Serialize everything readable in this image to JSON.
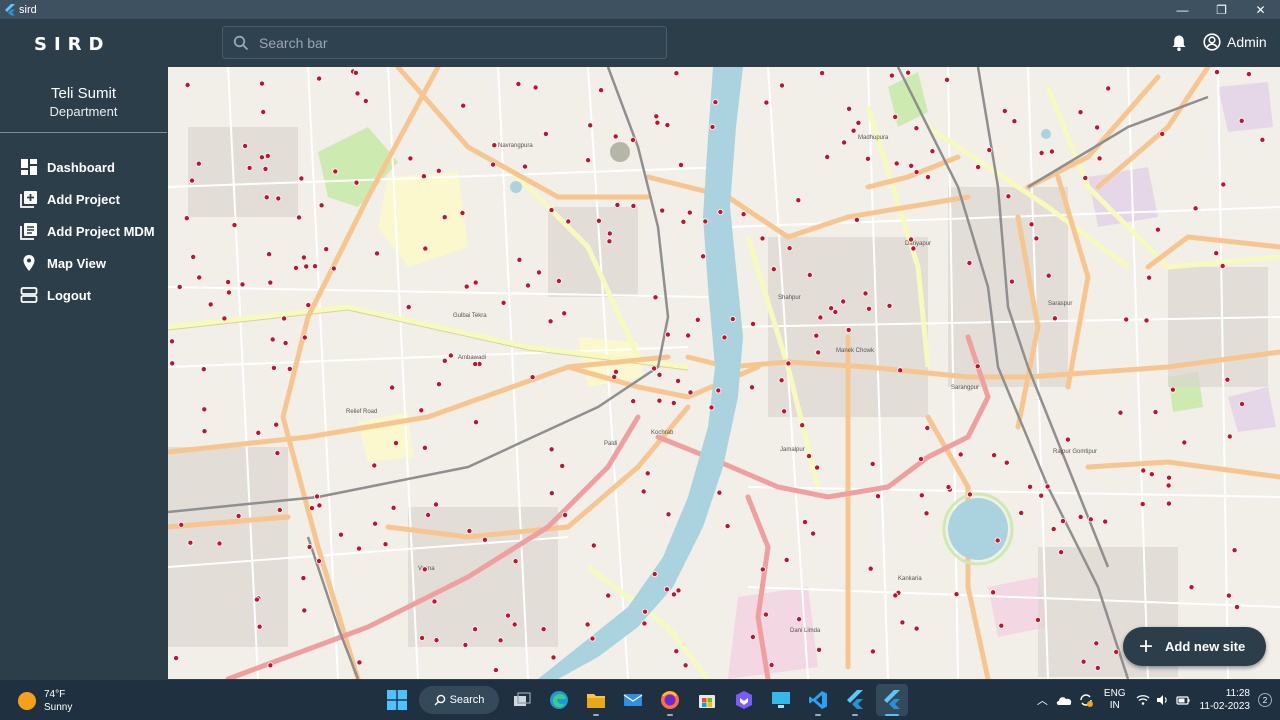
{
  "window": {
    "title": "sird",
    "minimize": "—",
    "maximize": "❐",
    "close": "✕"
  },
  "header": {
    "logo": "SIRD",
    "search_placeholder": "Search bar",
    "user_label": "Admin"
  },
  "sidebar": {
    "profile_name": "Teli Sumit",
    "profile_role": "Department",
    "items": [
      {
        "label": "Dashboard",
        "icon": "dashboard-icon"
      },
      {
        "label": "Add Project",
        "icon": "add-box-icon"
      },
      {
        "label": "Add Project MDM",
        "icon": "library-add-icon"
      },
      {
        "label": "Map View",
        "icon": "location-pin-icon"
      },
      {
        "label": "Logout",
        "icon": "storage-icon"
      }
    ]
  },
  "map": {
    "marker_color": "#c8102e",
    "labels": [
      "Gulbai Tekra",
      "Ambawadi",
      "Paldi",
      "Kochrab",
      "Jamalpur",
      "Manek Chowk",
      "Dariyapur",
      "Sarangpur",
      "Shahpur",
      "Navrangpura",
      "Vasna",
      "Relief Road",
      "Kankaria",
      "Saraspur",
      "Rajpur Gomtipur",
      "Madhupura",
      "Dani Limda"
    ]
  },
  "fab": {
    "label": "Add new site"
  },
  "taskbar": {
    "temperature": "74°F",
    "condition": "Sunny",
    "search_label": "Search",
    "lang_top": "ENG",
    "lang_bottom": "IN",
    "time": "11:28",
    "date": "11-02-2023",
    "notifications": "2"
  }
}
